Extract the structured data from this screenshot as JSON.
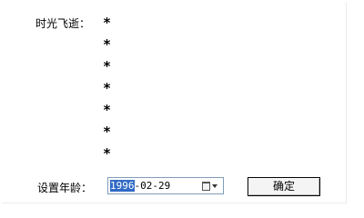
{
  "form": {
    "time_label": "时光飞逝：",
    "stars": [
      "*",
      "*",
      "*",
      "*",
      "*",
      "*",
      "*"
    ],
    "age_label": "设置年龄：",
    "date": {
      "selected_part": "1996",
      "rest": "-02-29",
      "icon": "calendar-dropdown-icon"
    },
    "confirm_label": "确定"
  }
}
